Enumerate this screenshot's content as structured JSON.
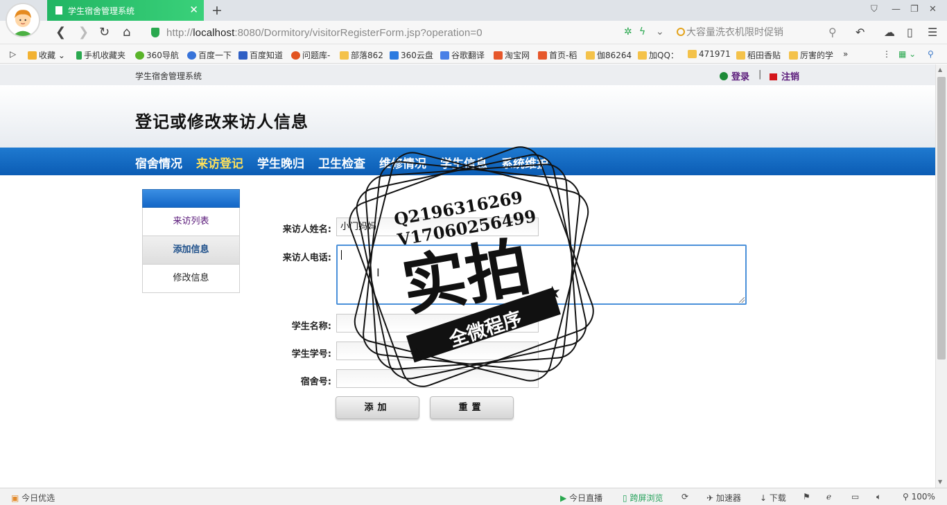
{
  "browser": {
    "tab_title": "学生宿舍管理系统",
    "url_prefix": "http://",
    "url_host": "localhost",
    "url_rest": ":8080/Dormitory/visitorRegisterForm.jsp?operation=0",
    "search_text": "大容量洗衣机限时促销",
    "bookmarks": [
      "收藏",
      "手机收藏夹",
      "360导航",
      "百度一下",
      "百度知道",
      "问题库-",
      "部落862",
      "360云盘",
      "谷歌翻译",
      "淘宝网",
      "首页-稻",
      "伽86264",
      "加QQ：",
      "471971",
      "稻田香贴",
      "厉害的学"
    ],
    "status": {
      "left": "今日优选",
      "live": "今日直播",
      "cross_screen": "跨屏浏览",
      "accelerator": "加速器",
      "download": "下载",
      "zoom": "100%"
    }
  },
  "site": {
    "name": "学生宿舍管理系统",
    "login": "登录",
    "separator": "|",
    "logout": "注销",
    "page_title": "登记或修改来访人信息",
    "nav": [
      "宿舍情况",
      "来访登记",
      "学生晚归",
      "卫生检查",
      "维修情况",
      "学生信息",
      "系统维护"
    ],
    "sidebar": [
      "来访列表",
      "添加信息",
      "修改信息"
    ]
  },
  "form": {
    "visitor_name_label": "来访人姓名:",
    "visitor_name_value": "小门妈妈",
    "visitor_phone_label": "来访人电话:",
    "student_name_label": "学生名称:",
    "student_id_label": "学生学号:",
    "dorm_no_label": "宿舍号:",
    "add_button": "添加",
    "reset_button": "重置"
  },
  "watermark": {
    "line1": "Q2196316269",
    "line2": "V17060256499",
    "main": "实拍",
    "banner": "全微程序"
  },
  "colors": {
    "nav_blue": "#0b5cb4",
    "nav_active": "#ffe15a",
    "tab_green": "#21b563"
  }
}
